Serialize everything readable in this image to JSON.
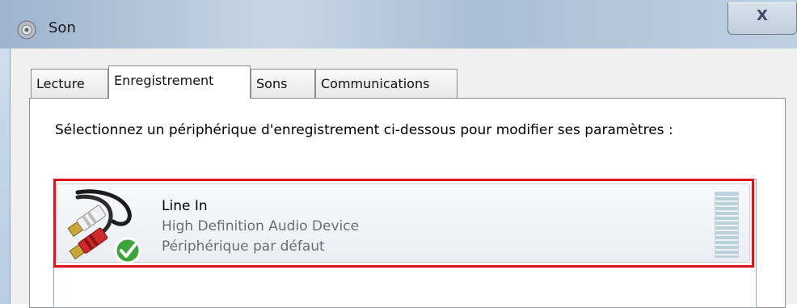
{
  "window": {
    "title": "Son",
    "close_label": "X"
  },
  "tabs": [
    {
      "label": "Lecture",
      "active": false
    },
    {
      "label": "Enregistrement",
      "active": true
    },
    {
      "label": "Sons",
      "active": false
    },
    {
      "label": "Communications",
      "active": false
    }
  ],
  "panel": {
    "instruction": "Sélectionnez un périphérique d'enregistrement ci-dessous pour modifier ses paramètres :"
  },
  "devices": [
    {
      "name": "Line In",
      "description": "High Definition Audio Device",
      "status": "Périphérique par défaut",
      "icon": "rca-cable-icon",
      "default_badge_icon": "green-check-icon",
      "selected": true
    }
  ],
  "colors": {
    "highlight": "#e0161e",
    "check_green": "#3aa53a"
  }
}
